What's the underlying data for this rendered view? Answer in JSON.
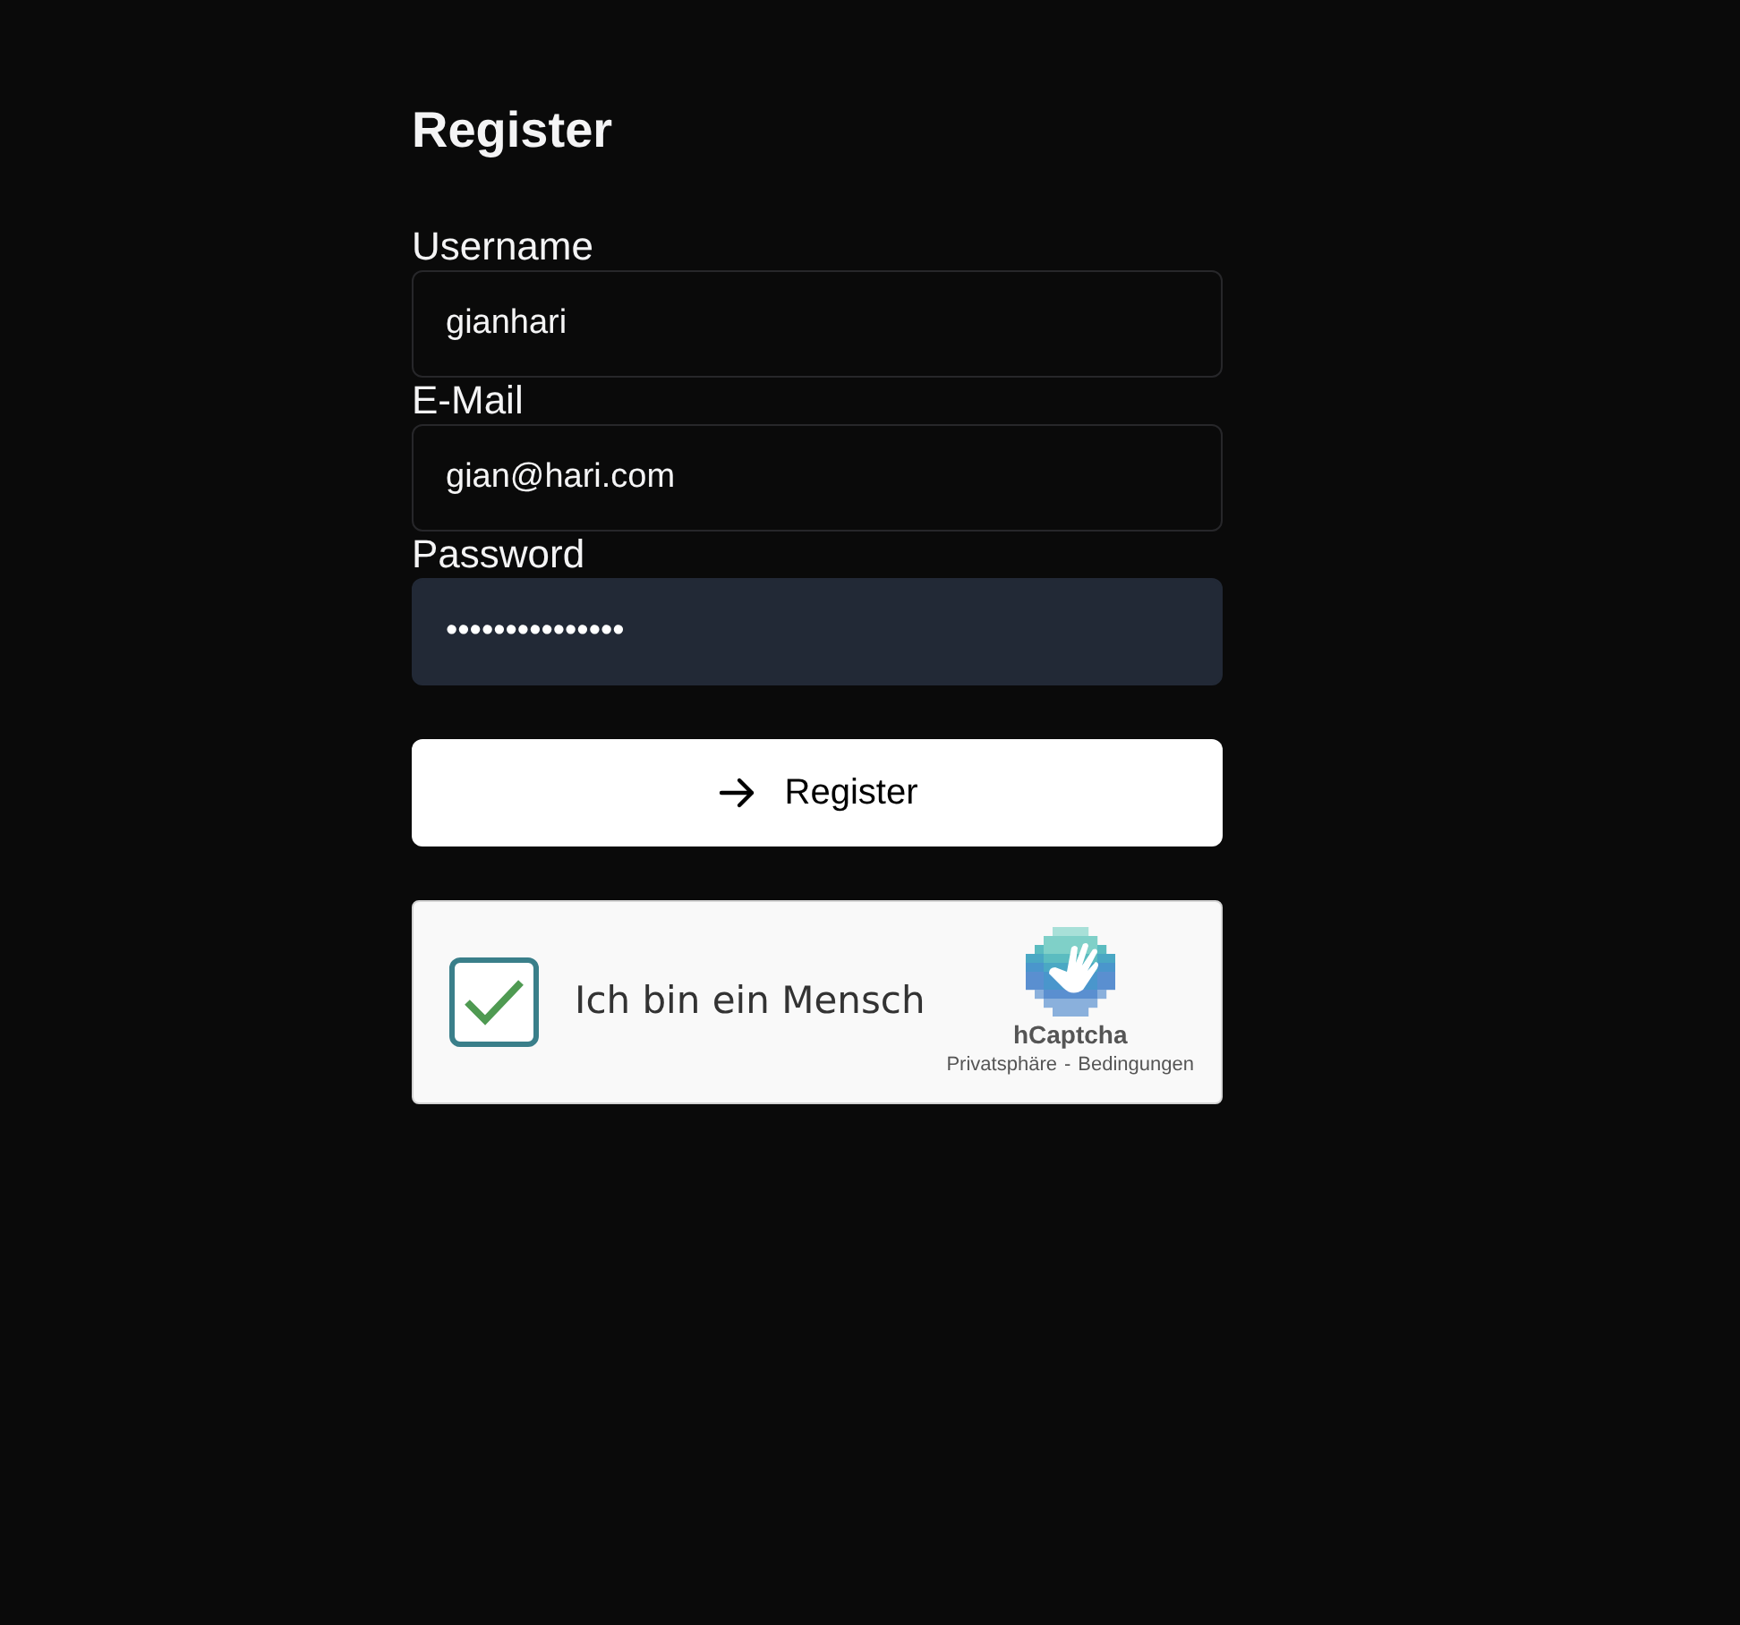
{
  "title": "Register",
  "fields": [
    {
      "label": "Username",
      "value": "gianhari",
      "focused": false
    },
    {
      "label": "E-Mail",
      "value": "gian@hari.com",
      "focused": false
    },
    {
      "label": "Password",
      "value": "•••••••••••••••",
      "focused": true
    }
  ],
  "submit": {
    "label": "Register"
  },
  "captcha": {
    "label": "Ich bin ein Mensch",
    "checked": true,
    "brand": "hCaptcha",
    "links": [
      "Privatsphäre",
      "Bedingungen"
    ],
    "separator": "-"
  }
}
